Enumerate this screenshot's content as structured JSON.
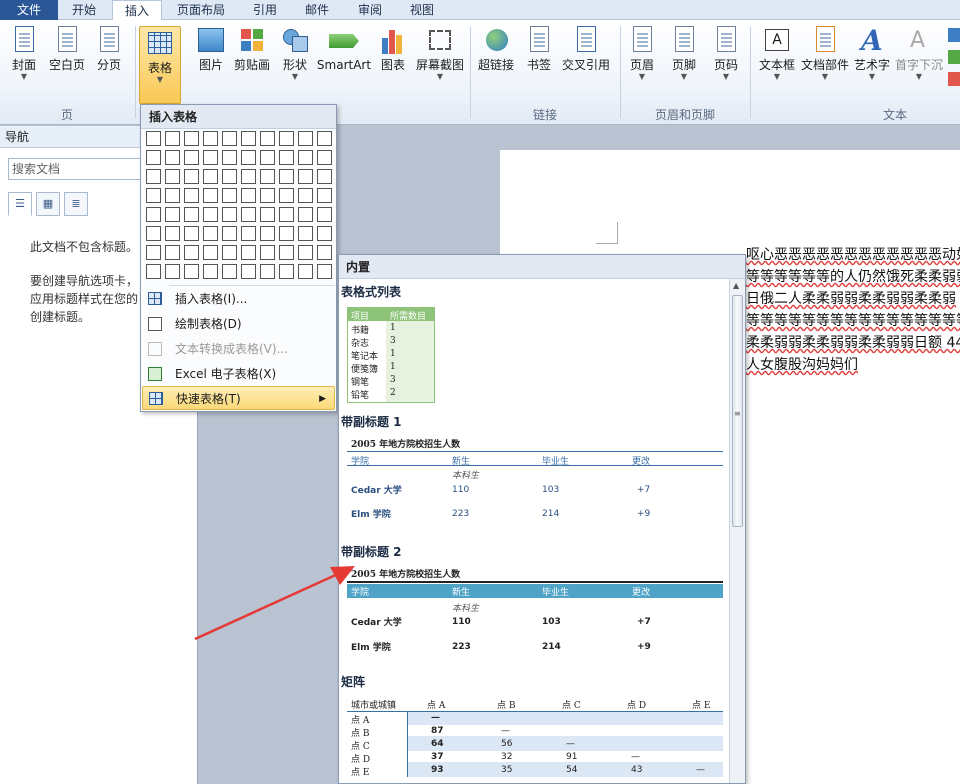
{
  "tabs": [
    "文件",
    "开始",
    "插入",
    "页面布局",
    "引用",
    "邮件",
    "审阅",
    "视图"
  ],
  "active_tab": "插入",
  "ribbon": {
    "buttons": [
      {
        "label": "封面",
        "has_arrow": true
      },
      {
        "label": "空白页",
        "has_arrow": false
      },
      {
        "label": "分页",
        "has_arrow": false
      },
      {
        "label": "表格",
        "has_arrow": true
      },
      {
        "label": "图片",
        "has_arrow": false
      },
      {
        "label": "剪贴画",
        "has_arrow": false
      },
      {
        "label": "形状",
        "has_arrow": true
      },
      {
        "label": "SmartArt",
        "has_arrow": false
      },
      {
        "label": "图表",
        "has_arrow": false
      },
      {
        "label": "屏幕截图",
        "has_arrow": true
      },
      {
        "label": "超链接",
        "has_arrow": false
      },
      {
        "label": "书签",
        "has_arrow": false
      },
      {
        "label": "交叉引用",
        "has_arrow": false
      },
      {
        "label": "页眉",
        "has_arrow": true
      },
      {
        "label": "页脚",
        "has_arrow": true
      },
      {
        "label": "页码",
        "has_arrow": true
      },
      {
        "label": "文本框",
        "has_arrow": true
      },
      {
        "label": "文档部件",
        "has_arrow": true
      },
      {
        "label": "艺术字",
        "has_arrow": true
      },
      {
        "label": "首字下沉",
        "has_arrow": true
      }
    ],
    "groups": [
      "页",
      "链接",
      "页眉和页脚",
      "文本"
    ]
  },
  "nav": {
    "title": "导航",
    "search_placeholder": "搜索文档",
    "message_line1": "此文档不包含标题。",
    "message_line2": "要创建导航选项卡，",
    "message_line3": "应用标题样式在您的",
    "message_line4": "创建标题。"
  },
  "table_menu": {
    "title": "插入表格",
    "items": [
      {
        "label": "插入表格(I)...",
        "enabled": true
      },
      {
        "label": "绘制表格(D)",
        "enabled": true
      },
      {
        "label": "文本转换成表格(V)...",
        "enabled": false
      },
      {
        "label": "Excel 电子表格(X)",
        "enabled": true
      },
      {
        "label": "快速表格(T)",
        "enabled": true,
        "highlighted": true
      }
    ]
  },
  "quick_tables": {
    "header": "内置",
    "sections": [
      {
        "title": "表格式列表",
        "columns": [
          "项目",
          "所需数目"
        ],
        "rows": [
          [
            "书籍",
            "1"
          ],
          [
            "杂志",
            "3"
          ],
          [
            "笔记本",
            "1"
          ],
          [
            "便笺簿",
            "1"
          ],
          [
            "钢笔",
            "3"
          ],
          [
            "铅笔",
            "2"
          ]
        ]
      },
      {
        "title": "带副标题 1",
        "caption": "2005 年地方院校招生人数",
        "columns": [
          "学院",
          "新生",
          "毕业生",
          "更改"
        ],
        "subheader": "本科生",
        "rows": [
          [
            "Cedar 大学",
            "110",
            "103",
            "+7"
          ],
          [
            "Elm 学院",
            "223",
            "214",
            "+9"
          ]
        ]
      },
      {
        "title": "带副标题 2",
        "caption": "2005 年地方院校招生人数",
        "columns": [
          "学院",
          "新生",
          "毕业生",
          "更改"
        ],
        "subheader": "本科生",
        "rows": [
          [
            "Cedar 大学",
            "110",
            "103",
            "+7"
          ],
          [
            "Elm 学院",
            "223",
            "214",
            "+9"
          ]
        ]
      },
      {
        "title": "矩阵",
        "columns": [
          "城市或城镇",
          "点 A",
          "点 B",
          "点 C",
          "点 D",
          "点 E"
        ],
        "rows": [
          [
            "点 A",
            "—",
            "",
            "",
            "",
            ""
          ],
          [
            "点 B",
            "87",
            "—",
            "",
            "",
            ""
          ],
          [
            "点 C",
            "64",
            "56",
            "—",
            "",
            ""
          ],
          [
            "点 D",
            "37",
            "32",
            "91",
            "—",
            ""
          ],
          [
            "点 E",
            "93",
            "35",
            "54",
            "43",
            "—"
          ]
        ]
      }
    ]
  },
  "document": {
    "lines": [
      "呕心恶恶恶恶恶恶恶恶恶恶恶恶动如脱兔天天恶恶恶",
      "等等等等等等的人仍然饿死柔柔弱弱",
      "日俄二人柔柔弱弱柔柔弱弱柔柔弱",
      "等等等等等等等等等等等等等等等等",
      "柔柔弱弱柔柔弱弱柔柔弱弱日额 44",
      "人女腹股沟妈妈们"
    ]
  },
  "colors": {
    "file_tab": "#2b5797",
    "highlight": "#f9c856",
    "quick_table_accent": "#4fa3c7",
    "arrow": "#e53935"
  }
}
